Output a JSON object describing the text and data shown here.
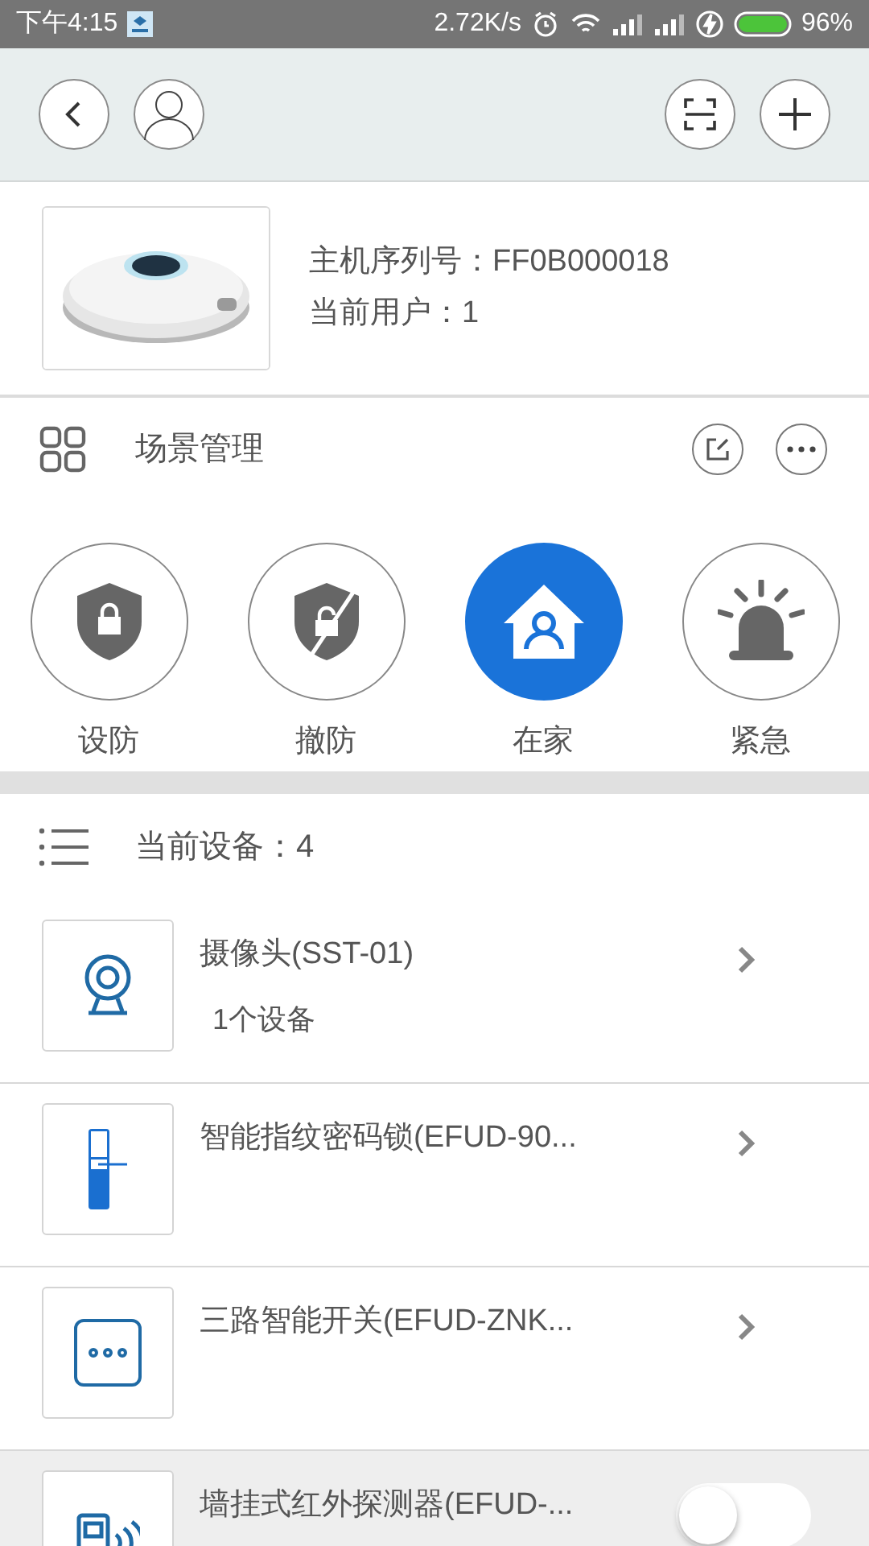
{
  "status_bar": {
    "time": "下午4:15",
    "speed": "2.72K/s",
    "battery": "96%"
  },
  "host": {
    "serial_label": "主机序列号：",
    "serial": "FF0B000018",
    "users_label": "当前用户：",
    "users": "1"
  },
  "scenes": {
    "title": "场景管理",
    "modes": [
      {
        "label": "设防",
        "kind": "arm",
        "selected": false
      },
      {
        "label": "撤防",
        "kind": "disarm",
        "selected": false
      },
      {
        "label": "在家",
        "kind": "home",
        "selected": true
      },
      {
        "label": "紧急",
        "kind": "alarm",
        "selected": false
      }
    ]
  },
  "devices": {
    "title": "当前设备：",
    "count": "4",
    "items": [
      {
        "name": "摄像头(SST-01)",
        "detail": "1个设备",
        "kind": "link",
        "selected": false
      },
      {
        "name": "智能指纹密码锁(EFUD-90...",
        "kind": "link",
        "selected": false
      },
      {
        "name": "三路智能开关(EFUD-ZNK...",
        "kind": "link",
        "selected": false
      },
      {
        "name": "墙挂式红外探测器(EFUD-...",
        "kind": "toggle",
        "on": false,
        "selected": true
      }
    ]
  }
}
